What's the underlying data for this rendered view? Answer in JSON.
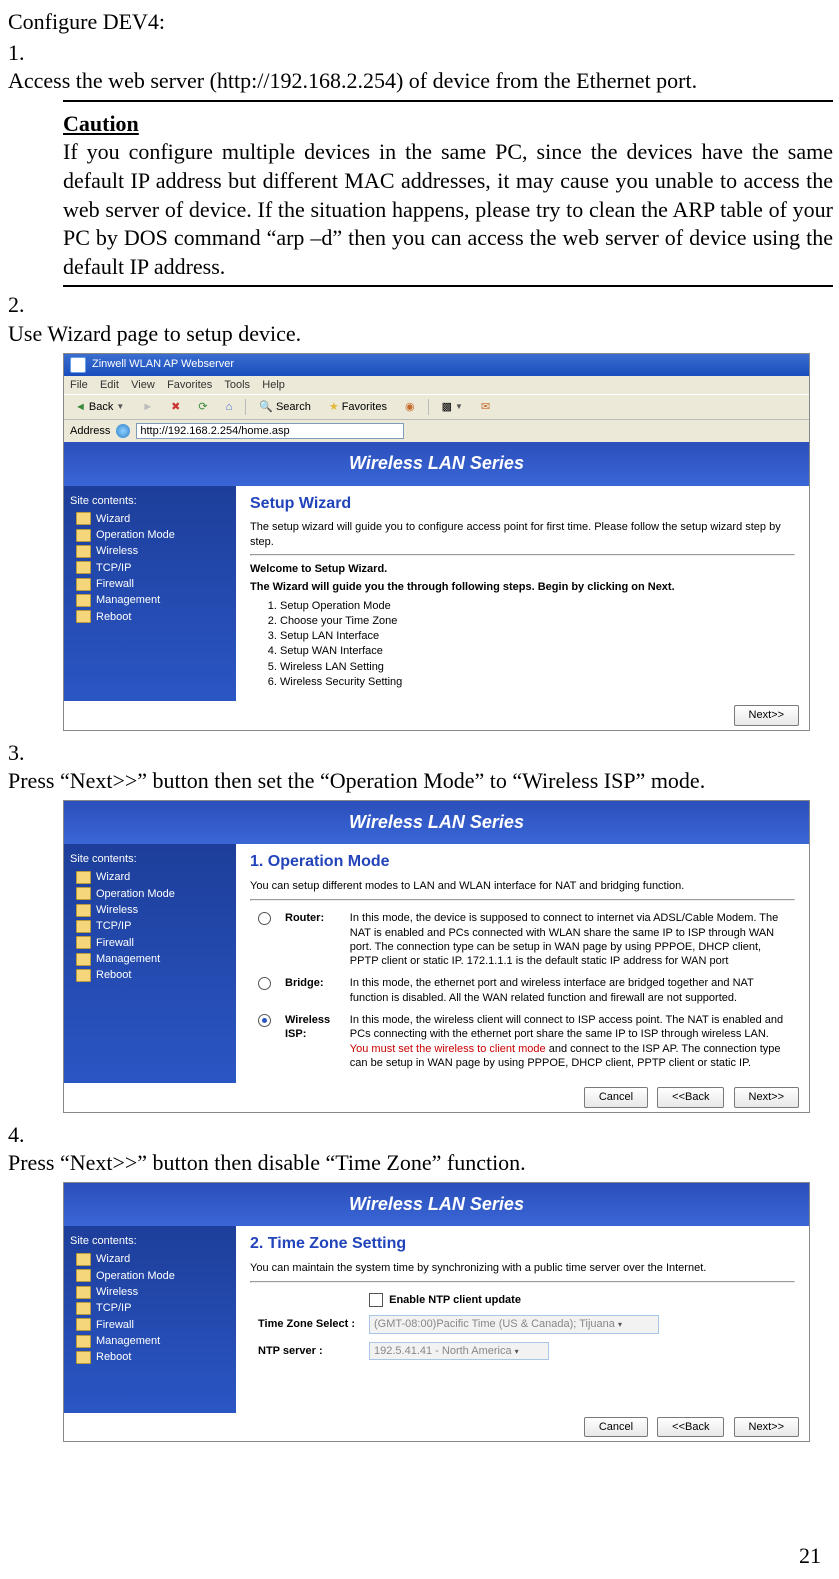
{
  "doc": {
    "intro": "Configure DEV4:",
    "step1_num": "1.",
    "step1_text": "Access the web server (http://192.168.2.254) of device from the Ethernet port.",
    "caution_title": "Caution",
    "caution_text": "If you configure multiple devices in the same PC, since the devices have the same default IP address but different MAC addresses, it may cause you unable to access the web server of device. If the situation happens, please try to clean the ARP table of your PC by DOS command “arp –d” then you can access the web server of device using the default IP address.",
    "step2_num": "2.",
    "step2_text": "Use Wizard page to setup device.",
    "step3_num": "3.",
    "step3_text": "Press “Next>>” button then set the “Operation Mode” to “Wireless ISP” mode.",
    "step4_num": "4.",
    "step4_text": "Press “Next>>” button then disable “Time Zone” function.",
    "page_num": "21"
  },
  "ie": {
    "title": "Zinwell WLAN AP Webserver",
    "menu": {
      "file": "File",
      "edit": "Edit",
      "view": "View",
      "favorites": "Favorites",
      "tools": "Tools",
      "help": "Help"
    },
    "toolbar": {
      "back": "Back",
      "search": "Search",
      "favorites": "Favorites"
    },
    "addr_label": "Address",
    "addr_value": "http://192.168.2.254/home.asp"
  },
  "banner": "Wireless LAN Series",
  "sidebar": {
    "title": "Site contents:",
    "items": [
      "Wizard",
      "Operation Mode",
      "Wireless",
      "TCP/IP",
      "Firewall",
      "Management",
      "Reboot"
    ]
  },
  "wiz": {
    "title": "Setup Wizard",
    "desc": "The setup wizard will guide you to configure access point for first time. Please follow the setup wizard step by step.",
    "welcome": "Welcome to Setup Wizard.",
    "guide": "The Wizard will guide you the through following steps. Begin by clicking on Next.",
    "steps": [
      "Setup Operation Mode",
      "Choose your Time Zone",
      "Setup LAN Interface",
      "Setup WAN Interface",
      "Wireless LAN Setting",
      "Wireless Security Setting"
    ],
    "next_btn": "Next>>"
  },
  "op": {
    "title": "1. Operation Mode",
    "desc": "You can setup different modes to LAN and WLAN interface for NAT and bridging function.",
    "router_label": "Router:",
    "router_text": "In this mode, the device is supposed to connect to internet via ADSL/Cable Modem. The NAT is enabled and PCs connected with WLAN share the same IP to ISP through WAN port. The connection type can be setup in WAN page by using PPPOE, DHCP client, PPTP client or static IP. 172.1.1.1 is the default static IP address for WAN port",
    "bridge_label": "Bridge:",
    "bridge_text": "In this mode, the ethernet port and wireless interface are bridged together and NAT function is disabled. All the WAN related function and firewall are not supported.",
    "wisp_label": "Wireless ISP:",
    "wisp_text1": "In this mode, the wireless client will connect to ISP access point. The NAT is enabled and PCs connecting with the ethernet port share the same IP to ISP through wireless LAN. ",
    "wisp_red": "You must set the wireless to client mode",
    "wisp_text2": " and connect to the ISP AP. The connection type can be setup in WAN page by using PPPOE, DHCP client, PPTP client or static IP.",
    "cancel_btn": "Cancel",
    "back_btn": "<<Back",
    "next_btn": "Next>>"
  },
  "tz": {
    "title": "2. Time Zone Setting",
    "desc": "You can maintain the system time by synchronizing with a public time server over the Internet.",
    "enable_label": "Enable NTP client update",
    "tz_label": "Time Zone Select :",
    "tz_value": "(GMT-08:00)Pacific Time (US & Canada); Tijuana",
    "ntp_label": "NTP server :",
    "ntp_value": "192.5.41.41 - North America",
    "cancel_btn": "Cancel",
    "back_btn": "<<Back",
    "next_btn": "Next>>"
  }
}
